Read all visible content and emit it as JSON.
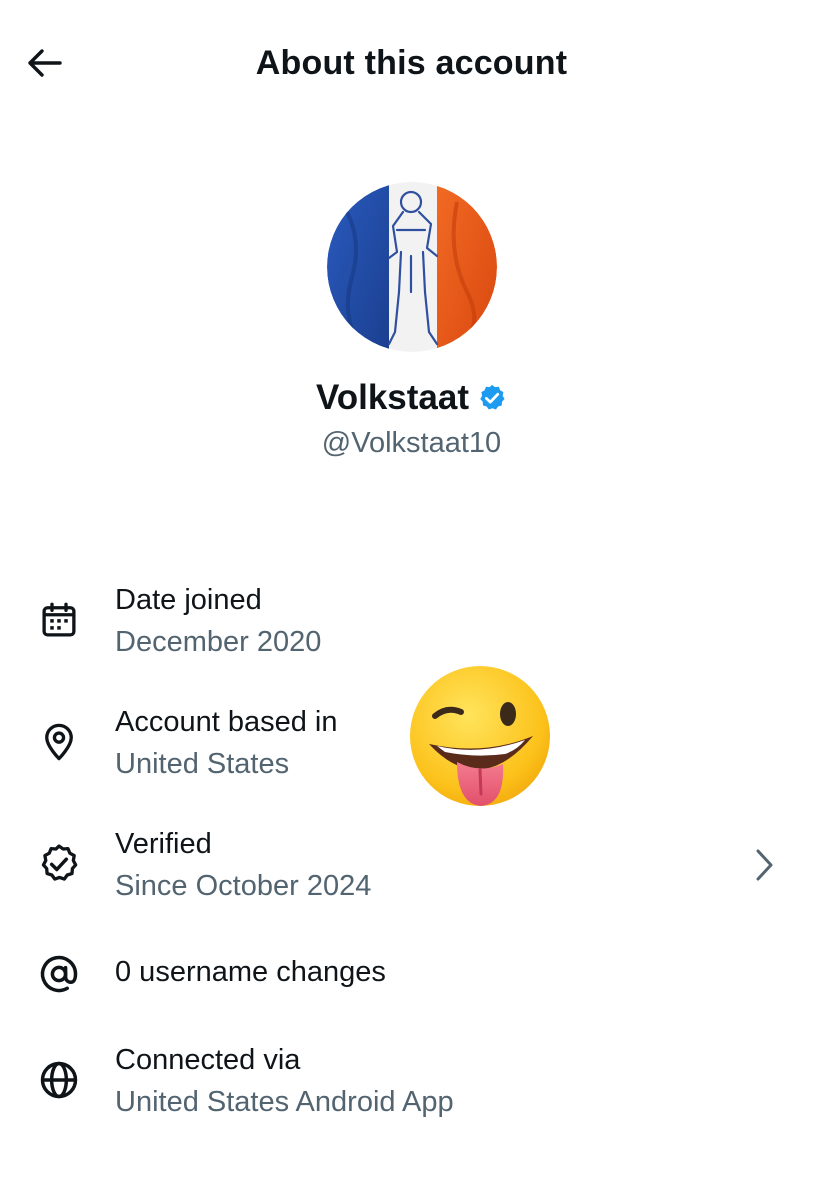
{
  "header": {
    "title": "About this account",
    "back_icon": "arrow-left-icon"
  },
  "profile": {
    "display_name": "Volkstaat",
    "handle": "@Volkstaat10",
    "verified_badge": "verified-check-icon",
    "badge_color": "#1d9bf0",
    "avatar_description_colors": [
      "#1f4fa8",
      "#ffffff",
      "#ee5a1a"
    ]
  },
  "info": {
    "date_joined": {
      "icon": "calendar-icon",
      "title": "Date joined",
      "value": "December 2020"
    },
    "based_in": {
      "icon": "location-pin-icon",
      "title": "Account based in",
      "value": "United States"
    },
    "verified": {
      "icon": "verified-seal-icon",
      "title": "Verified",
      "value": "Since October 2024",
      "chevron": "chevron-right-icon"
    },
    "username_changes": {
      "icon": "at-sign-icon",
      "title": "0 username changes"
    },
    "connected_via": {
      "icon": "globe-icon",
      "title": "Connected via",
      "value": "United States Android App"
    }
  },
  "overlay": {
    "sticker": "winking-face-with-tongue-emoji"
  },
  "colors": {
    "text_primary": "#0f1419",
    "text_secondary": "#536471",
    "background": "#ffffff"
  }
}
